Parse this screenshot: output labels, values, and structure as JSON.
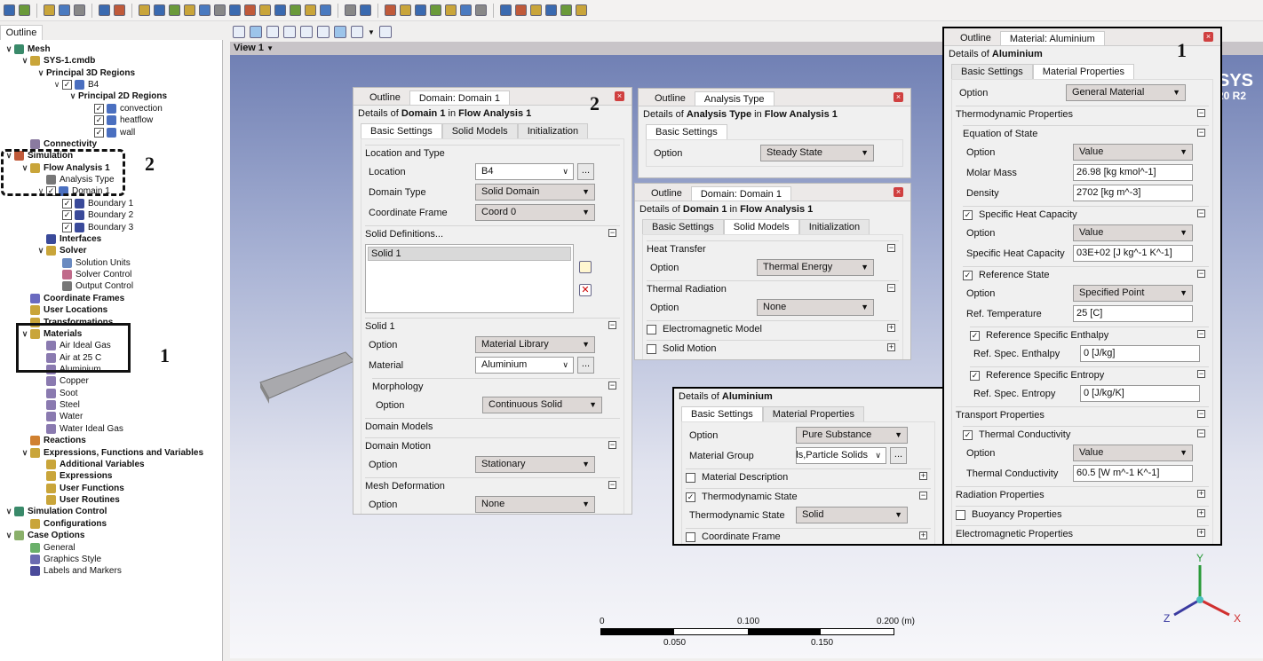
{
  "toolbar": {
    "icons": [
      "save",
      "refresh",
      "edit-mesh",
      "mesh-import",
      "camera",
      "undo",
      "redo",
      "open-folder",
      "domain",
      "line",
      "point",
      "plane",
      "isosurface",
      "volume",
      "material",
      "reaction",
      "expression",
      "table",
      "report",
      "function",
      "timer",
      "solver-manager",
      "domain-tool",
      "boundary",
      "subdomain",
      "point-source",
      "source",
      "interface",
      "coordinate-frame",
      "solution-units",
      "output-control",
      "transformation",
      "mesh-adapt",
      "grid",
      "copy"
    ]
  },
  "outline": {
    "tab": "Outline"
  },
  "tree": [
    {
      "label": "Mesh",
      "level": 0,
      "bold": true,
      "expanded": true,
      "icon": "mesh-icon",
      "iconColor": "#3a8a6a"
    },
    {
      "label": "SYS-1.cmdb",
      "level": 1,
      "bold": true,
      "expanded": true,
      "icon": "mesh-file-icon",
      "iconColor": "#c9a53a"
    },
    {
      "label": "Principal 3D Regions",
      "level": 2,
      "bold": true,
      "expanded": true
    },
    {
      "label": "B4",
      "level": 3,
      "expanded": true,
      "checked": true,
      "icon": "body-icon",
      "iconColor": "#4a6fc0"
    },
    {
      "label": "Principal 2D Regions",
      "level": 4,
      "bold": true,
      "expanded": true
    },
    {
      "label": "convection",
      "level": 5,
      "checked": true,
      "icon": "surface-icon",
      "iconColor": "#4a6fc0"
    },
    {
      "label": "heatflow",
      "level": 5,
      "checked": true,
      "icon": "surface-icon",
      "iconColor": "#4a6fc0"
    },
    {
      "label": "wall",
      "level": 5,
      "checked": true,
      "icon": "surface-icon",
      "iconColor": "#4a6fc0"
    },
    {
      "label": "Connectivity",
      "level": 1,
      "bold": true,
      "icon": "connectivity-icon",
      "iconColor": "#8a7aa0"
    },
    {
      "label": "Simulation",
      "level": 0,
      "bold": true,
      "expanded": true,
      "icon": "simulation-icon",
      "iconColor": "#c05a3a"
    },
    {
      "label": "Flow Analysis 1",
      "level": 1,
      "bold": true,
      "expanded": true,
      "icon": "flow-analysis-icon",
      "iconColor": "#c9a53a"
    },
    {
      "label": "Analysis Type",
      "level": 2,
      "icon": "clock-icon",
      "iconColor": "#777"
    },
    {
      "label": "Domain 1",
      "level": 2,
      "expanded": true,
      "checked": true,
      "icon": "domain-icon",
      "iconColor": "#4a6fc0"
    },
    {
      "label": "Boundary 1",
      "level": 3,
      "checked": true,
      "icon": "boundary-icon",
      "iconColor": "#3a4a9a"
    },
    {
      "label": "Boundary 2",
      "level": 3,
      "checked": true,
      "icon": "boundary-icon",
      "iconColor": "#3a4a9a"
    },
    {
      "label": "Boundary 3",
      "level": 3,
      "checked": true,
      "icon": "boundary-icon",
      "iconColor": "#3a4a9a"
    },
    {
      "label": "Interfaces",
      "level": 2,
      "bold": true,
      "icon": "interfaces-icon",
      "iconColor": "#3a4a9a"
    },
    {
      "label": "Solver",
      "level": 2,
      "bold": true,
      "expanded": true,
      "icon": "solver-icon",
      "iconColor": "#c9a53a"
    },
    {
      "label": "Solution Units",
      "level": 3,
      "icon": "units-icon",
      "iconColor": "#6a8ac0"
    },
    {
      "label": "Solver Control",
      "level": 3,
      "icon": "solver-control-icon",
      "iconColor": "#c06a8a"
    },
    {
      "label": "Output Control",
      "level": 3,
      "icon": "output-control-icon",
      "iconColor": "#777"
    },
    {
      "label": "Coordinate Frames",
      "level": 1,
      "bold": true,
      "icon": "coordinate-frames-icon",
      "iconColor": "#6a6ac0"
    },
    {
      "label": "User Locations",
      "level": 1,
      "bold": true,
      "icon": "folder-icon",
      "iconColor": "#c9a53a"
    },
    {
      "label": "Transformations",
      "level": 1,
      "bold": true,
      "icon": "folder-icon",
      "iconColor": "#c9a53a"
    },
    {
      "label": "Materials",
      "level": 1,
      "bold": true,
      "expanded": true,
      "icon": "materials-icon",
      "iconColor": "#c9a53a"
    },
    {
      "label": "Air Ideal Gas",
      "level": 2,
      "icon": "flask-icon",
      "iconColor": "#8a7ab0"
    },
    {
      "label": "Air at 25 C",
      "level": 2,
      "icon": "flask-icon",
      "iconColor": "#8a7ab0"
    },
    {
      "label": "Aluminium",
      "level": 2,
      "icon": "flask-icon",
      "iconColor": "#8a7ab0"
    },
    {
      "label": "Copper",
      "level": 2,
      "icon": "flask-icon",
      "iconColor": "#8a7ab0"
    },
    {
      "label": "Soot",
      "level": 2,
      "icon": "flask-icon",
      "iconColor": "#8a7ab0"
    },
    {
      "label": "Steel",
      "level": 2,
      "icon": "flask-icon",
      "iconColor": "#8a7ab0"
    },
    {
      "label": "Water",
      "level": 2,
      "icon": "flask-icon",
      "iconColor": "#8a7ab0"
    },
    {
      "label": "Water Ideal Gas",
      "level": 2,
      "icon": "flask-icon",
      "iconColor": "#8a7ab0"
    },
    {
      "label": "Reactions",
      "level": 1,
      "bold": true,
      "icon": "reactions-icon",
      "iconColor": "#d08030"
    },
    {
      "label": "Expressions, Functions and Variables",
      "level": 1,
      "bold": true,
      "expanded": true,
      "icon": "expressions-icon",
      "iconColor": "#c9a53a"
    },
    {
      "label": "Additional Variables",
      "level": 2,
      "bold": true,
      "icon": "variables-icon",
      "iconColor": "#c9a53a"
    },
    {
      "label": "Expressions",
      "level": 2,
      "bold": true,
      "icon": "expression-icon",
      "iconColor": "#c9a53a"
    },
    {
      "label": "User Functions",
      "level": 2,
      "bold": true,
      "icon": "function-icon",
      "iconColor": "#c9a53a"
    },
    {
      "label": "User Routines",
      "level": 2,
      "bold": true,
      "icon": "routine-icon",
      "iconColor": "#c9a53a"
    },
    {
      "label": "Simulation Control",
      "level": 0,
      "bold": true,
      "expanded": true,
      "icon": "simulation-control-icon",
      "iconColor": "#3a8a6a"
    },
    {
      "label": "Configurations",
      "level": 1,
      "bold": true,
      "icon": "configurations-icon",
      "iconColor": "#c9a53a"
    },
    {
      "label": "Case Options",
      "level": 0,
      "bold": true,
      "expanded": true,
      "icon": "case-options-icon",
      "iconColor": "#8ab06a"
    },
    {
      "label": "General",
      "level": 1,
      "icon": "general-icon",
      "iconColor": "#6ab06a"
    },
    {
      "label": "Graphics Style",
      "level": 1,
      "icon": "graphics-style-icon",
      "iconColor": "#6a6ab0"
    },
    {
      "label": "Labels and Markers",
      "level": 1,
      "icon": "labels-icon",
      "iconColor": "#4a4a9a"
    }
  ],
  "annotations": {
    "one": "1",
    "two": "2"
  },
  "viewer": {
    "title": "View 1",
    "logo_top": "SYS",
    "logo_bottom": "20 R2",
    "scale": {
      "top": [
        "0",
        "0.100",
        "0.200"
      ],
      "unit": "(m)",
      "bottom": [
        "0.050",
        "0.150"
      ]
    },
    "axes": {
      "x": "X",
      "y": "Y",
      "z": "Z"
    }
  },
  "panels": [
    {
      "id": "domain-basic",
      "tabs": [
        "Outline",
        "Domain: Domain 1"
      ],
      "active_tab": 1,
      "details": [
        "Details of ",
        "Domain 1",
        " in ",
        "Flow Analysis 1"
      ],
      "inner_tabs": [
        "Basic Settings",
        "Solid Models",
        "Initialization"
      ],
      "active_inner": 0,
      "rows": [
        {
          "t": "group",
          "title": "Location and Type"
        },
        {
          "t": "field",
          "label": "Location",
          "value": "B4",
          "control": "combo",
          "dots": true
        },
        {
          "t": "field",
          "label": "Domain Type",
          "value": "Solid Domain",
          "control": "select"
        },
        {
          "t": "field",
          "label": "Coordinate Frame",
          "value": "Coord 0",
          "control": "select"
        },
        {
          "t": "group",
          "title": "Solid Definitions...",
          "coll": "-"
        },
        {
          "t": "list",
          "items": [
            "Solid 1"
          ]
        },
        {
          "t": "group",
          "title": "Solid 1",
          "coll": "-"
        },
        {
          "t": "field",
          "label": "Option",
          "value": "Material Library",
          "control": "select"
        },
        {
          "t": "field",
          "label": "Material",
          "value": "Aluminium",
          "control": "combo",
          "dots": true
        },
        {
          "t": "group",
          "title": "Morphology",
          "coll": "-",
          "depth": 1
        },
        {
          "t": "field",
          "label": "Option",
          "value": "Continuous Solid",
          "control": "select",
          "depth": 1
        },
        {
          "t": "group",
          "title": "Domain Models"
        },
        {
          "t": "group",
          "title": "Domain Motion",
          "coll": "-"
        },
        {
          "t": "field",
          "label": "Option",
          "value": "Stationary",
          "control": "select"
        },
        {
          "t": "group",
          "title": "Mesh Deformation",
          "coll": "-"
        },
        {
          "t": "field",
          "label": "Option",
          "value": "None",
          "control": "select"
        }
      ]
    },
    {
      "id": "analysis-type",
      "tabs": [
        "Outline",
        "Analysis Type"
      ],
      "active_tab": 1,
      "details": [
        "Details of ",
        "Analysis Type",
        " in ",
        "Flow Analysis 1"
      ],
      "inner_tabs": [
        "Basic Settings"
      ],
      "active_inner": 0,
      "rows": [
        {
          "t": "field",
          "label": "Option",
          "value": "Steady State",
          "control": "select"
        }
      ]
    },
    {
      "id": "domain-solid-models",
      "tabs": [
        "Outline",
        "Domain: Domain 1"
      ],
      "active_tab": 1,
      "details": [
        "Details of ",
        "Domain 1",
        " in ",
        "Flow Analysis 1"
      ],
      "inner_tabs": [
        "Basic Settings",
        "Solid Models",
        "Initialization"
      ],
      "active_inner": 1,
      "rows": [
        {
          "t": "group",
          "title": "Heat Transfer",
          "coll": "-"
        },
        {
          "t": "field",
          "label": "Option",
          "value": "Thermal Energy",
          "control": "select"
        },
        {
          "t": "group",
          "title": "Thermal Radiation",
          "coll": "-"
        },
        {
          "t": "field",
          "label": "Option",
          "value": "None",
          "control": "select"
        },
        {
          "t": "group",
          "title": "Electromagnetic Model",
          "coll": "+",
          "checkbox": false
        },
        {
          "t": "group",
          "title": "Solid Motion",
          "coll": "+",
          "checkbox": false
        }
      ]
    },
    {
      "id": "aluminium-basic",
      "tabs": [],
      "details": [
        "Details of ",
        "Aluminium",
        "",
        ""
      ],
      "inner_tabs": [
        "Basic Settings",
        "Material Properties"
      ],
      "active_inner": 0,
      "rows": [
        {
          "t": "field",
          "label": "Option",
          "value": "Pure Substance",
          "control": "select"
        },
        {
          "t": "field",
          "label": "Material Group",
          "value": "CHT Solids,Particle Solids",
          "control": "combo",
          "dots": true,
          "clip": true
        },
        {
          "t": "group",
          "title": "Material Description",
          "coll": "+",
          "checkbox": false
        },
        {
          "t": "group",
          "title": "Thermodynamic State",
          "coll": "-",
          "checkbox": true
        },
        {
          "t": "field",
          "label": "Thermodynamic State",
          "value": "Solid",
          "control": "select"
        },
        {
          "t": "group",
          "title": "Coordinate Frame",
          "coll": "+",
          "checkbox": false
        }
      ]
    },
    {
      "id": "aluminium-material-properties",
      "tabs": [
        "Outline",
        "Material: Aluminium"
      ],
      "active_tab": 1,
      "details": [
        "Details of ",
        "Aluminium",
        "",
        ""
      ],
      "inner_tabs": [
        "Basic Settings",
        "Material Properties"
      ],
      "active_inner": 1,
      "rows": [
        {
          "t": "field",
          "label": "Option",
          "value": "General Material",
          "control": "select"
        },
        {
          "t": "group",
          "title": "Thermodynamic Properties",
          "coll": "-"
        },
        {
          "t": "group",
          "title": "Equation of State",
          "coll": "-",
          "depth": 1
        },
        {
          "t": "field",
          "label": "Option",
          "value": "Value",
          "control": "select",
          "depth": 1
        },
        {
          "t": "field",
          "label": "Molar Mass",
          "value": "26.98 [kg kmol^-1]",
          "control": "input",
          "depth": 1
        },
        {
          "t": "field",
          "label": "Density",
          "value": "2702 [kg m^-3]",
          "control": "input",
          "depth": 1
        },
        {
          "t": "group",
          "title": "Specific Heat Capacity",
          "coll": "-",
          "checkbox": true,
          "depth": 1
        },
        {
          "t": "field",
          "label": "Option",
          "value": "Value",
          "control": "select",
          "depth": 1
        },
        {
          "t": "field",
          "label": "Specific Heat Capacity",
          "value": "03E+02 [J kg^-1 K^-1]",
          "control": "input",
          "depth": 1
        },
        {
          "t": "group",
          "title": "Reference State",
          "coll": "-",
          "checkbox": true,
          "depth": 1
        },
        {
          "t": "field",
          "label": "Option",
          "value": "Specified Point",
          "control": "select",
          "depth": 1
        },
        {
          "t": "field",
          "label": "Ref. Temperature",
          "value": "25 [C]",
          "control": "input",
          "depth": 1
        },
        {
          "t": "group",
          "title": "Reference Specific Enthalpy",
          "coll": "-",
          "checkbox": true,
          "depth": 2
        },
        {
          "t": "field",
          "label": "Ref. Spec. Enthalpy",
          "value": "0 [J/kg]",
          "control": "input",
          "depth": 2
        },
        {
          "t": "group",
          "title": "Reference Specific Entropy",
          "coll": "-",
          "checkbox": true,
          "depth": 2
        },
        {
          "t": "field",
          "label": "Ref. Spec. Entropy",
          "value": "0 [J/kg/K]",
          "control": "input",
          "depth": 2
        },
        {
          "t": "group",
          "title": "Transport Properties",
          "coll": "-"
        },
        {
          "t": "group",
          "title": "Thermal Conductivity",
          "coll": "-",
          "checkbox": true,
          "depth": 1
        },
        {
          "t": "field",
          "label": "Option",
          "value": "Value",
          "control": "select",
          "depth": 1
        },
        {
          "t": "field",
          "label": "Thermal Conductivity",
          "value": "60.5 [W m^-1 K^-1]",
          "control": "input",
          "depth": 1
        },
        {
          "t": "group",
          "title": "Radiation Properties",
          "coll": "+"
        },
        {
          "t": "group",
          "title": "Buoyancy Properties",
          "coll": "+",
          "checkbox": false
        },
        {
          "t": "group",
          "title": "Electromagnetic Properties",
          "coll": "+"
        }
      ]
    }
  ]
}
